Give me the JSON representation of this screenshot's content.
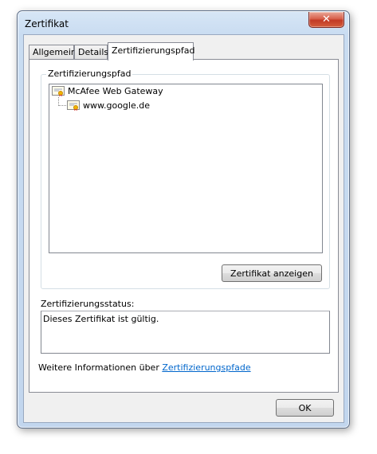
{
  "window": {
    "title": "Zertifikat",
    "close_glyph": "✕"
  },
  "tabs": [
    {
      "label": "Allgemein"
    },
    {
      "label": "Details"
    },
    {
      "label": "Zertifizierungspfad"
    }
  ],
  "cert_path": {
    "group_label": "Zertifizierungspfad",
    "items": [
      {
        "label": "McAfee Web Gateway",
        "icon": "certificate-icon"
      },
      {
        "label": "www.google.de",
        "icon": "certificate-icon"
      }
    ],
    "view_button": "Zertifikat anzeigen"
  },
  "status": {
    "label": "Zertifizierungsstatus:",
    "text": "Dieses Zertifikat ist gültig."
  },
  "info": {
    "prefix": "Weitere Informationen über ",
    "link": "Zertifizierungspfade"
  },
  "ok_button": "OK"
}
